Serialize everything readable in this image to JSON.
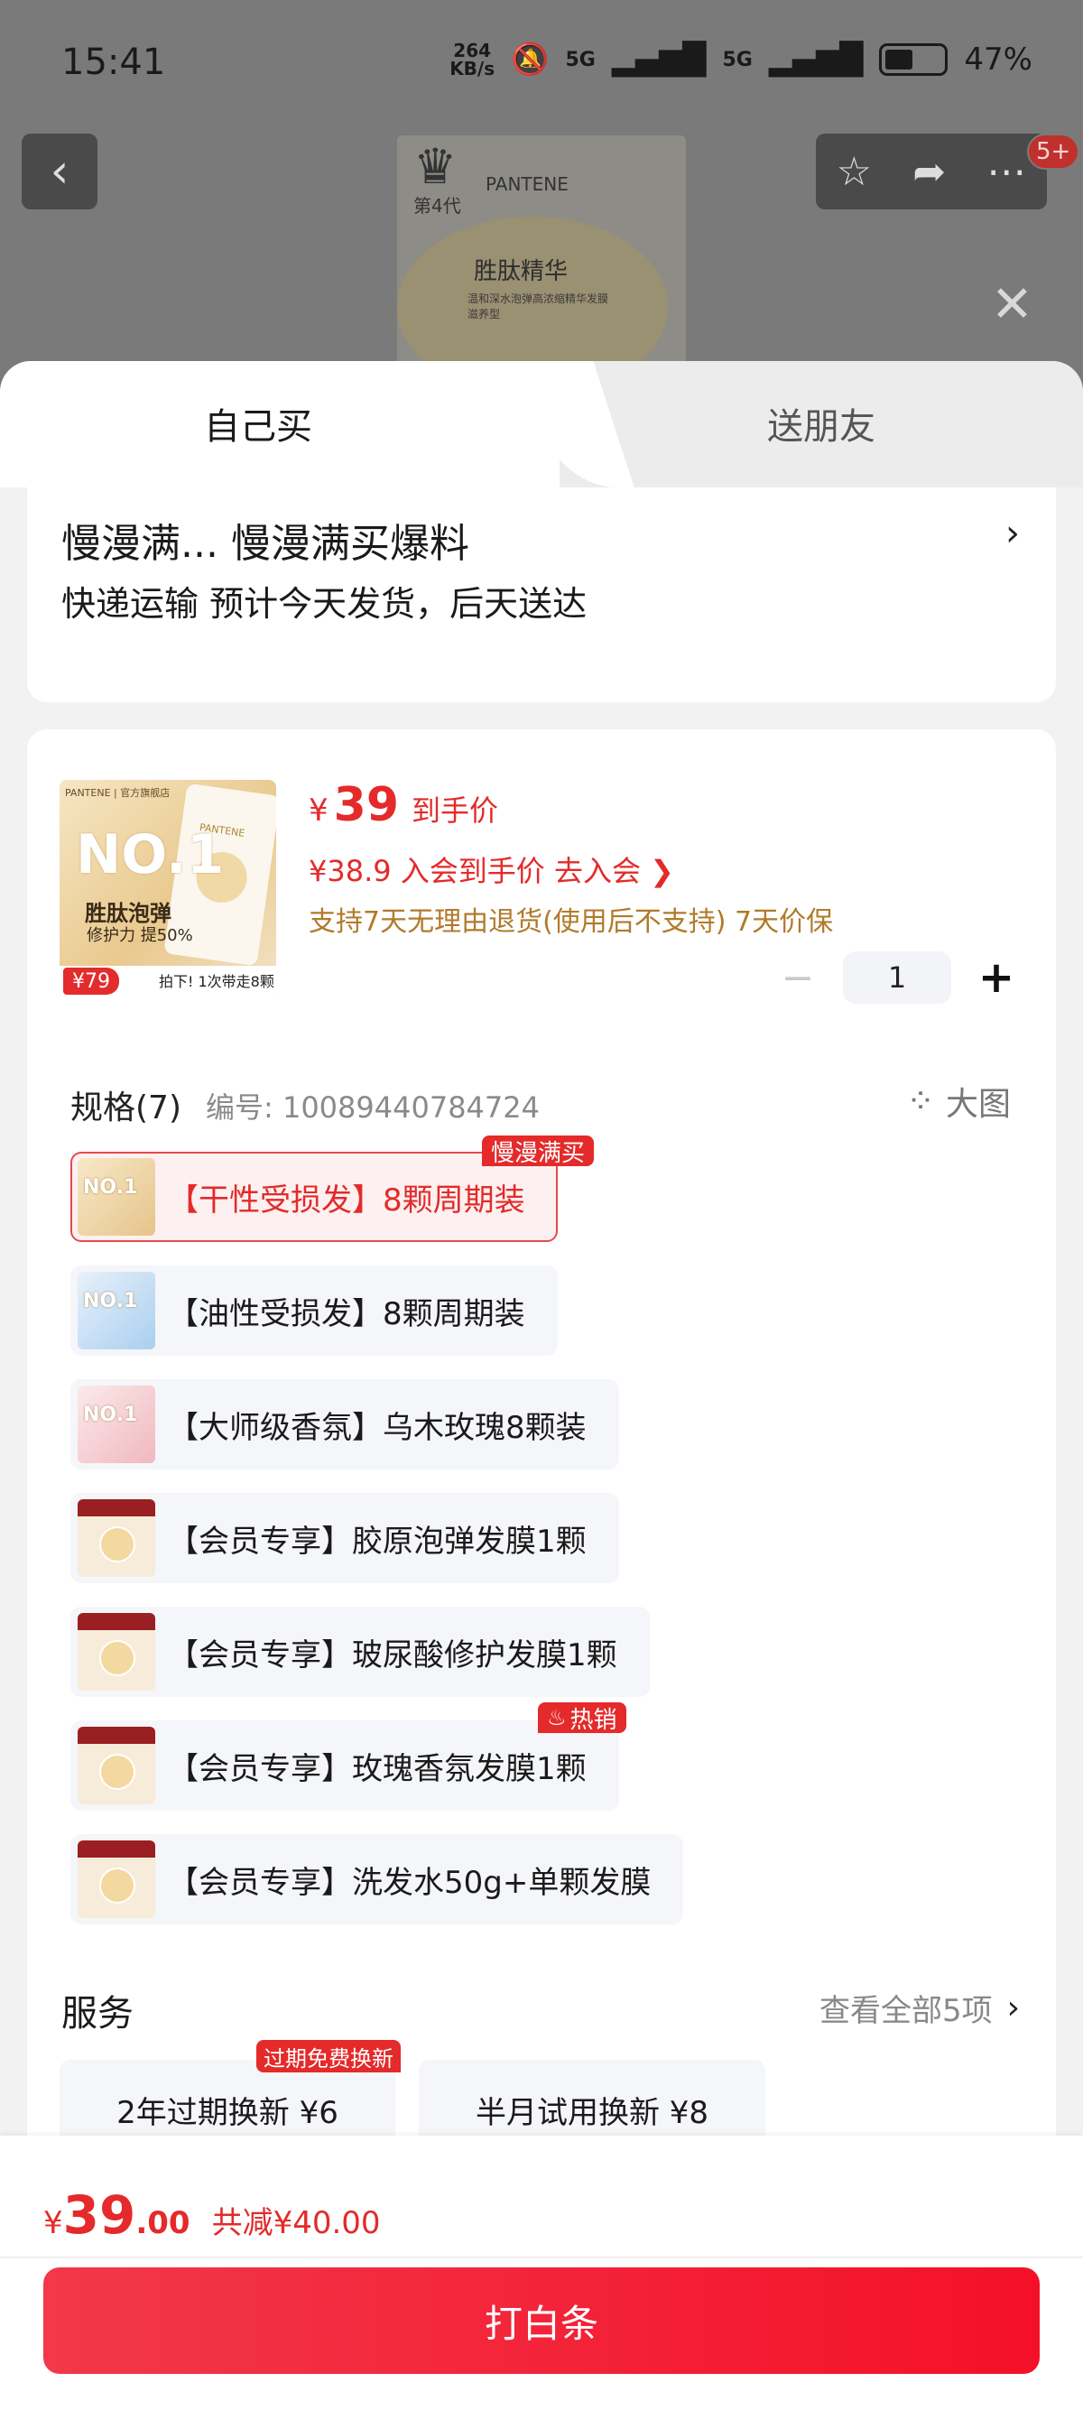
{
  "status_bar": {
    "time": "15:41",
    "net_speed": "264",
    "net_unit": "KB/s",
    "sig1": "5G",
    "sig2": "5G",
    "battery_percent": "47%",
    "battery_level": 0.47
  },
  "header": {
    "notification_count": "5+"
  },
  "background_product": {
    "generation": "第4代",
    "brand": "PANTENE",
    "title": "胜肽精华",
    "subtitle": "温和深水泡弹高浓缩精华发膜 滋养型",
    "code": "21716677"
  },
  "tabs": [
    {
      "label": "自己买",
      "selected": true
    },
    {
      "label": "送朋友",
      "selected": false
    }
  ],
  "address": {
    "line1": "慢漫满... 慢漫满买爆料",
    "line2": "快递运输 预计今天发货，后天送达"
  },
  "product": {
    "image": {
      "shop": "PANTENE | 官方旗舰店",
      "headline": "NO.1",
      "line1": "胜肽泡弹",
      "line2": "修护力 提50%",
      "price_tag": "¥79",
      "promo": "拍下! 1次带走8颗"
    },
    "currency": "¥",
    "price": "39",
    "price_label": "到手价",
    "vip_price_text": "¥38.9 入会到手价 去入会 ❯",
    "support_text": "支持7天无理由退货(使用后不支持) 7天价保",
    "quantity": "1"
  },
  "spec": {
    "title": "规格(7)",
    "number": "编号: 10089440784724",
    "big_image_label": "大图",
    "options": [
      {
        "label": "【干性受损发】8颗周期装",
        "selected": true
      },
      {
        "label": "【油性受损发】8颗周期装",
        "selected": false
      },
      {
        "label": "【大师级香氛】乌木玫瑰8颗装",
        "selected": false
      },
      {
        "label": "【会员专享】胶原泡弹发膜1颗",
        "selected": false
      },
      {
        "label": "【会员专享】玻尿酸修护发膜1颗",
        "selected": false
      },
      {
        "label": "【会员专享】玫瑰香氛发膜1颗",
        "selected": false
      },
      {
        "label": "【会员专享】洗发水50g+单颗发膜",
        "selected": false
      }
    ],
    "selected_tag": "慢漫满买",
    "hot_tag": "热销"
  },
  "services": {
    "title": "服务",
    "view_all": "查看全部5项",
    "items": [
      {
        "label": "2年过期换新 ¥6",
        "tag": "过期免费换新"
      },
      {
        "label": "半月试用换新 ¥8",
        "tag": ""
      }
    ]
  },
  "footer": {
    "currency": "¥",
    "total_int": "39",
    "total_dec": ".00",
    "discount": "共减¥40.00",
    "pay_label": "打白条"
  },
  "colors": {
    "accent": "#e42a2a",
    "pay_button": "#f41028",
    "sheet_bg": "#f2f2f2",
    "overlay": "#7a7a7a"
  }
}
